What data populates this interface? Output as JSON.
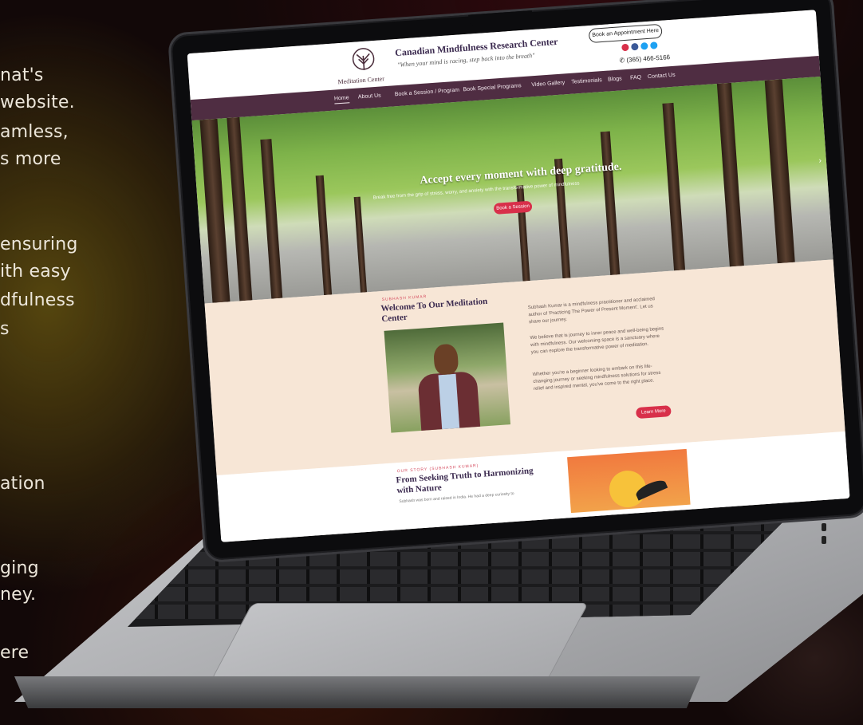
{
  "left_copy": {
    "lines": [
      "nat's",
      "website.",
      "amless,",
      "s more",
      "ensuring",
      "ith easy",
      "dfulness",
      "s",
      "ation",
      "ging",
      "ney.",
      "ere"
    ]
  },
  "site": {
    "logo_text": "Meditation Center",
    "title": "Canadian Mindfulness Research Center",
    "tagline": "\"When your mind is racing, step back into the breath\"",
    "appointment_label": "Book an Appointment Here",
    "phone": "✆ (365) 466-5166",
    "nav": [
      {
        "label": "Home",
        "active": true
      },
      {
        "label": "About Us"
      },
      {
        "label": "Book a Session / Program"
      },
      {
        "label": "Book Special Programs"
      },
      {
        "label": "Video Gallery"
      },
      {
        "label": "Testimonials"
      },
      {
        "label": "Blogs"
      },
      {
        "label": "FAQ"
      },
      {
        "label": "Contact Us"
      }
    ],
    "social_colors": [
      "#d8304a",
      "#3b5998",
      "#1da1f2",
      "#1da1f2"
    ]
  },
  "hero": {
    "heading": "Accept every moment with deep gratitude.",
    "subtext": "Break free from the grip of stress, worry, and anxiety with the transformative power of mindfulness",
    "button": "Book a Session",
    "arrow": "›"
  },
  "welcome": {
    "kicker": "SUBHASH KUMAR",
    "heading": "Welcome To Our Meditation Center",
    "paragraphs": [
      "Subhash Kumar is a mindfulness practitioner and acclaimed author of 'Practicing The Power of Present Moment'. Let us share our journey.",
      "We believe that is journey to inner peace and well-being begins with mindfulness. Our welcoming space is a sanctuary where you can explore the transformative power of meditation.",
      "Whether you're a beginner looking to embark on this life-changing journey or seeking mindfulness solutions for stress relief and inspired mental, you've come to the right place."
    ],
    "button": "Learn More"
  },
  "story": {
    "kicker": "OUR STORY (SUBHASH KUMAR)",
    "heading": "From Seeking Truth to Harmonizing with Nature",
    "para": "Subhash was born and raised in India. He had a deep curiosity to"
  }
}
